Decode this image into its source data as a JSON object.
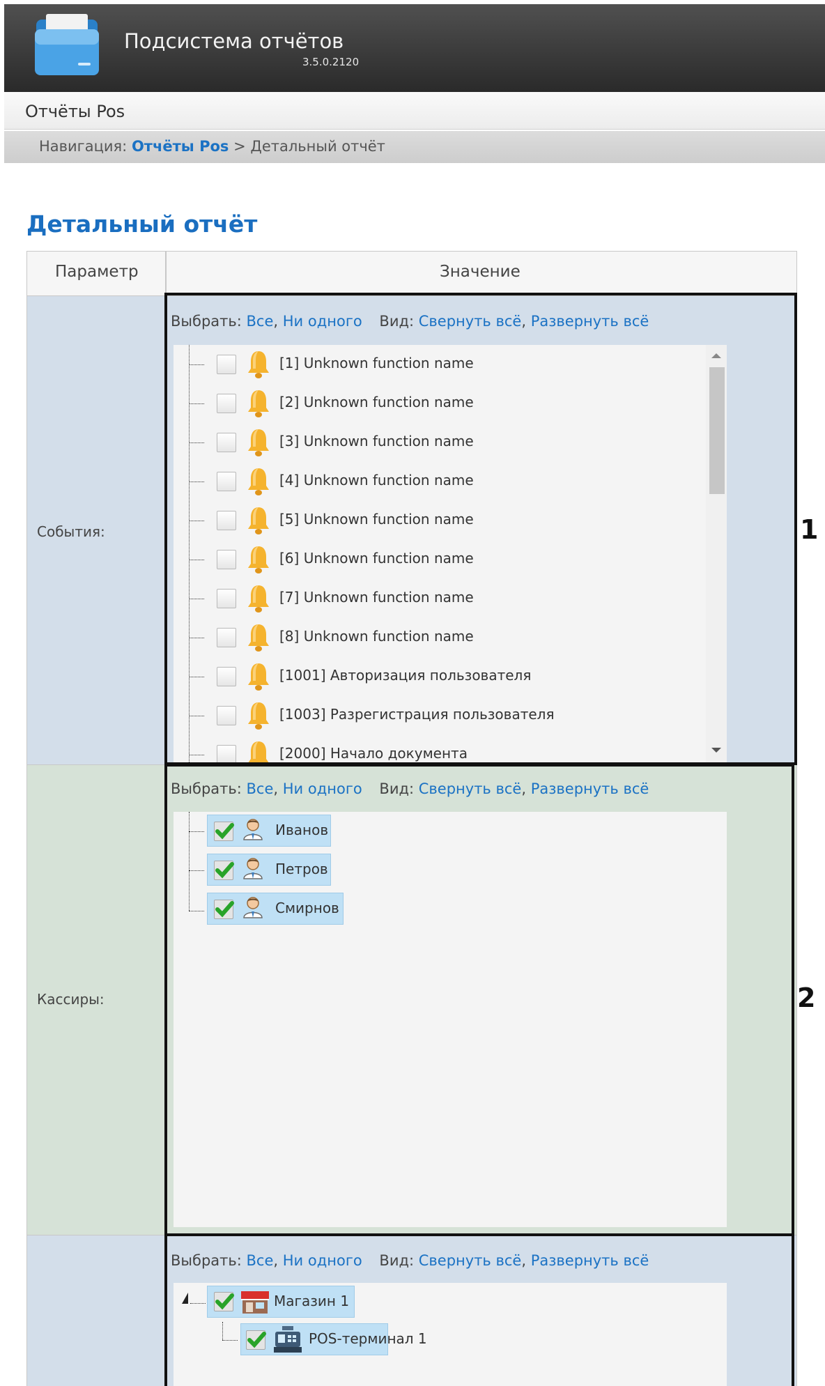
{
  "app": {
    "title": "Подсистема отчётов",
    "version": "3.5.0.2120"
  },
  "menu": {
    "item": "Отчёты Pos"
  },
  "breadcrumb": {
    "prefix": "Навигация:",
    "link": "Отчёты Pos",
    "separator": ">",
    "current": "Детальный отчёт"
  },
  "page_title": "Детальный отчёт",
  "table": {
    "col_param": "Параметр",
    "col_value": "Значение"
  },
  "selector": {
    "select_label": "Выбрать:",
    "all": "Все",
    "none": "Ни одного",
    "view_label": "Вид:",
    "collapse_all": "Свернуть всё",
    "expand_all": "Развернуть всё",
    "comma": ","
  },
  "events": {
    "label": "События:",
    "items": [
      "[1] Unknown function name",
      "[2] Unknown function name",
      "[3] Unknown function name",
      "[4] Unknown function name",
      "[5] Unknown function name",
      "[6] Unknown function name",
      "[7] Unknown function name",
      "[8] Unknown function name",
      "[1001] Авторизация пользователя",
      "[1003] Разрегистрация пользователя",
      "[2000] Начало документа"
    ],
    "icon": "bell-icon"
  },
  "cashiers": {
    "label": "Кассиры:",
    "items": [
      "Иванов",
      "Петров",
      "Смирнов"
    ],
    "icon": "user-icon"
  },
  "objects": {
    "shop": "Магазин 1",
    "terminal": "POS-терминал 1",
    "icons": [
      "shop-icon",
      "pos-terminal-icon"
    ]
  },
  "annotations": {
    "one": "1",
    "two": "2"
  },
  "colors": {
    "link": "#1b72c4",
    "events_bg": "#d3deea",
    "cashiers_bg": "#d6e2d7",
    "highlight": "#bfe0f5"
  }
}
